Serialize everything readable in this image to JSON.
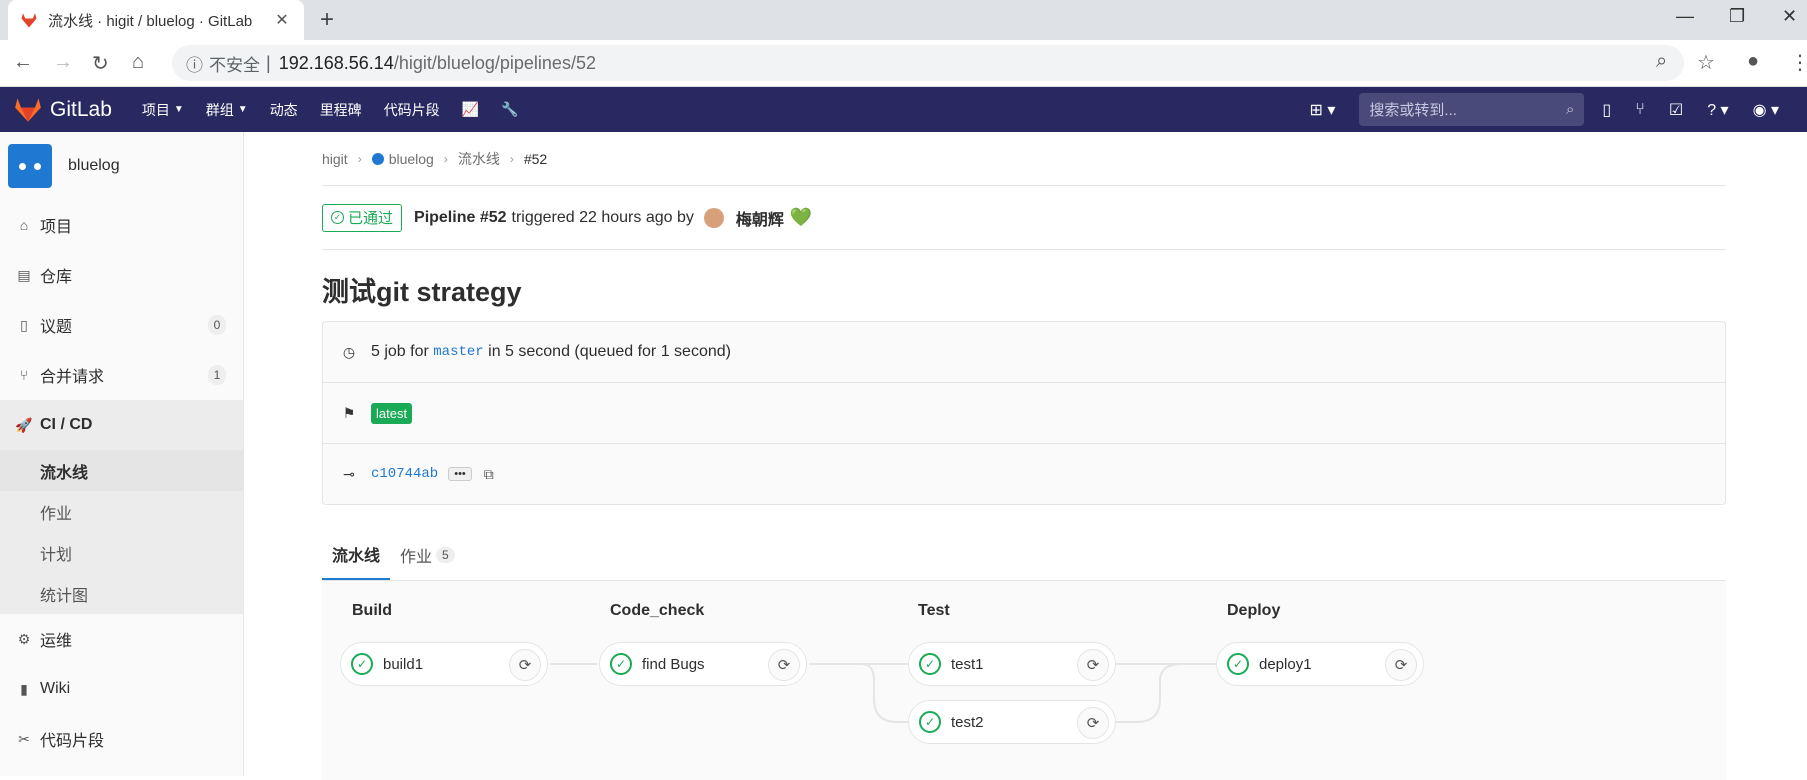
{
  "browser": {
    "tab_title": "流水线 · higit / bluelog · GitLab",
    "close_glyph": "✕",
    "new_tab_glyph": "+",
    "url_security": "不安全",
    "url_host": "192.168.56.14",
    "url_path": "/higit/bluelog/pipelines/52"
  },
  "topnav": {
    "brand": "GitLab",
    "menu": [
      "项目",
      "群组",
      "动态",
      "里程碑",
      "代码片段"
    ],
    "search_placeholder": "搜索或转到..."
  },
  "sidebar": {
    "project_name": "bluelog",
    "items": [
      {
        "label": "项目",
        "icon": "home-icon"
      },
      {
        "label": "仓库",
        "icon": "repo-icon"
      },
      {
        "label": "议题",
        "icon": "issues-icon",
        "count": "0"
      },
      {
        "label": "合并请求",
        "icon": "merge-request-icon",
        "count": "1"
      },
      {
        "label": "CI / CD",
        "icon": "rocket-icon"
      }
    ],
    "cicd_sub": [
      "流水线",
      "作业",
      "计划",
      "统计图"
    ],
    "after": [
      {
        "label": "运维",
        "icon": "cloud-gear-icon"
      },
      {
        "label": "Wiki",
        "icon": "book-icon"
      },
      {
        "label": "代码片段",
        "icon": "scissors-icon"
      }
    ]
  },
  "breadcrumb": [
    "higit",
    "bluelog",
    "流水线",
    "#52"
  ],
  "pipeline": {
    "status": "已通过",
    "name": "Pipeline #52",
    "triggered": "triggered 22 hours ago by",
    "user": "梅朝辉",
    "title": "测试git strategy",
    "jobs_prefix": "5 job for",
    "branch": "master",
    "jobs_suffix": "in 5 second (queued for 1 second)",
    "tag": "latest",
    "commit": "c10744ab",
    "ellipsis": "•••"
  },
  "tabs": {
    "pipeline": "流水线",
    "jobs": "作业",
    "jobs_count": "5"
  },
  "stages": [
    {
      "name": "Build",
      "jobs": [
        "build1"
      ]
    },
    {
      "name": "Code_check",
      "jobs": [
        "find Bugs"
      ]
    },
    {
      "name": "Test",
      "jobs": [
        "test1",
        "test2"
      ]
    },
    {
      "name": "Deploy",
      "jobs": [
        "deploy1"
      ]
    }
  ],
  "colors": {
    "nav": "#292961",
    "success": "#1aaa55",
    "link": "#1f78d1"
  }
}
